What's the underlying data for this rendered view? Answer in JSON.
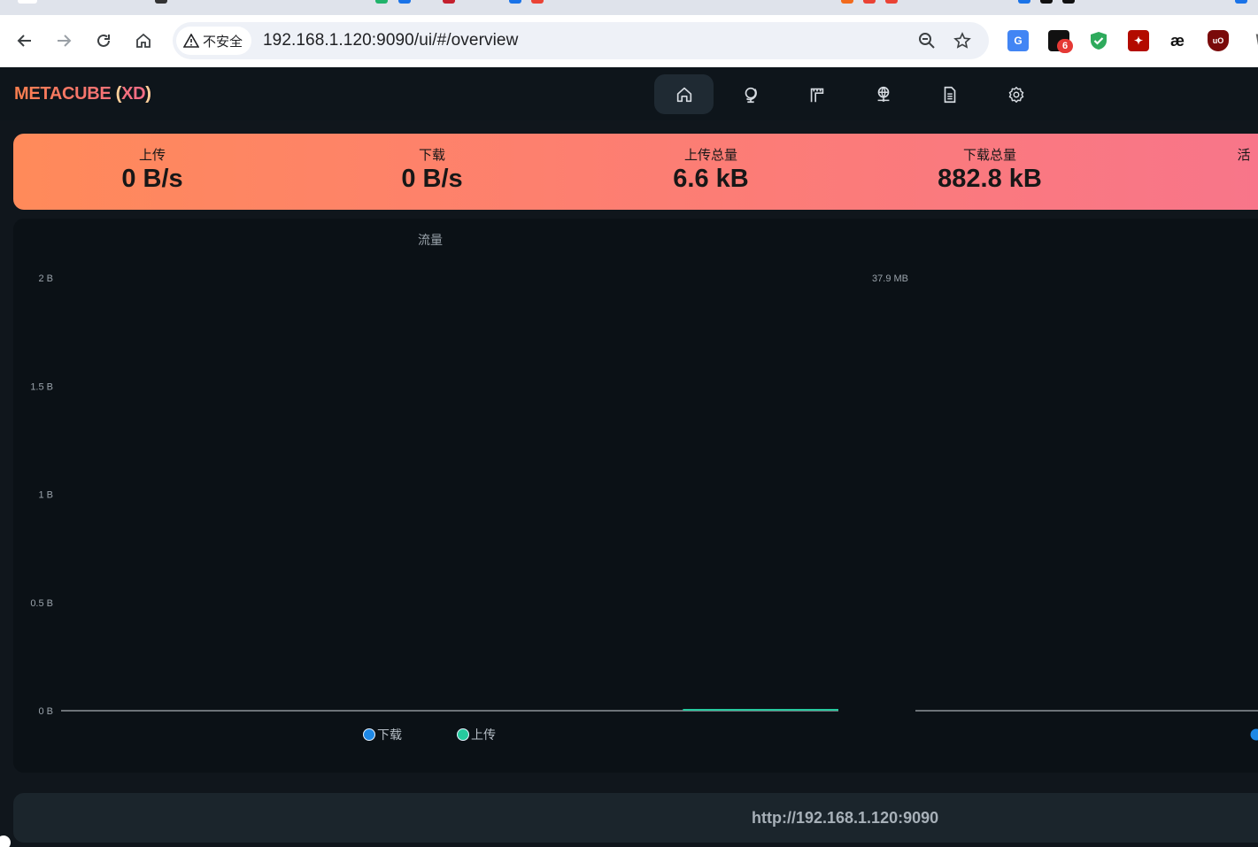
{
  "browser": {
    "security_label": "不安全",
    "url": "192.168.1.120:9090/ui/#/overview",
    "extension_badge": "6",
    "extensions": [
      "translate-icon",
      "tab-manager-icon",
      "shield-check-icon",
      "pdf-icon",
      "ae-icon",
      "ublock-icon"
    ]
  },
  "app": {
    "logo_text": "METACUBE",
    "logo_open": "(",
    "logo_suffix": "XD",
    "logo_close": ")",
    "nav": [
      "home-icon",
      "globe-icon",
      "rules-icon",
      "connections-icon",
      "logs-icon",
      "settings-icon"
    ],
    "active_nav": "home-icon"
  },
  "stats": [
    {
      "label": "上传",
      "value": "0 B/s"
    },
    {
      "label": "下载",
      "value": "0 B/s"
    },
    {
      "label": "上传总量",
      "value": "6.6 kB"
    },
    {
      "label": "下载总量",
      "value": "882.8 kB"
    },
    {
      "label": "活",
      "value": ""
    }
  ],
  "colors": {
    "download": "#1e88e5",
    "upload": "#26c99e",
    "banner_start": "#ff8a5a",
    "banner_end": "#f8758a"
  },
  "chart_data": [
    {
      "type": "line",
      "title": "流量",
      "y_ticks": [
        "2 B",
        "1.5 B",
        "1 B",
        "0.5 B",
        "0 B"
      ],
      "ylim": [
        0,
        2
      ],
      "series": [
        {
          "name": "下载",
          "values": [
            0,
            0,
            0,
            0,
            0,
            0,
            0,
            0,
            0,
            0
          ]
        },
        {
          "name": "上传",
          "values": [
            0,
            0,
            0,
            0,
            0,
            0,
            0,
            0,
            0,
            0
          ]
        }
      ],
      "legend": "bottom"
    },
    {
      "type": "line",
      "y_ticks": [
        "37.9 MB"
      ],
      "series": [
        {
          "name": "",
          "values": [
            0,
            0,
            0,
            0
          ]
        }
      ]
    }
  ],
  "footer": {
    "backend_url": "http://192.168.1.120:9090"
  }
}
